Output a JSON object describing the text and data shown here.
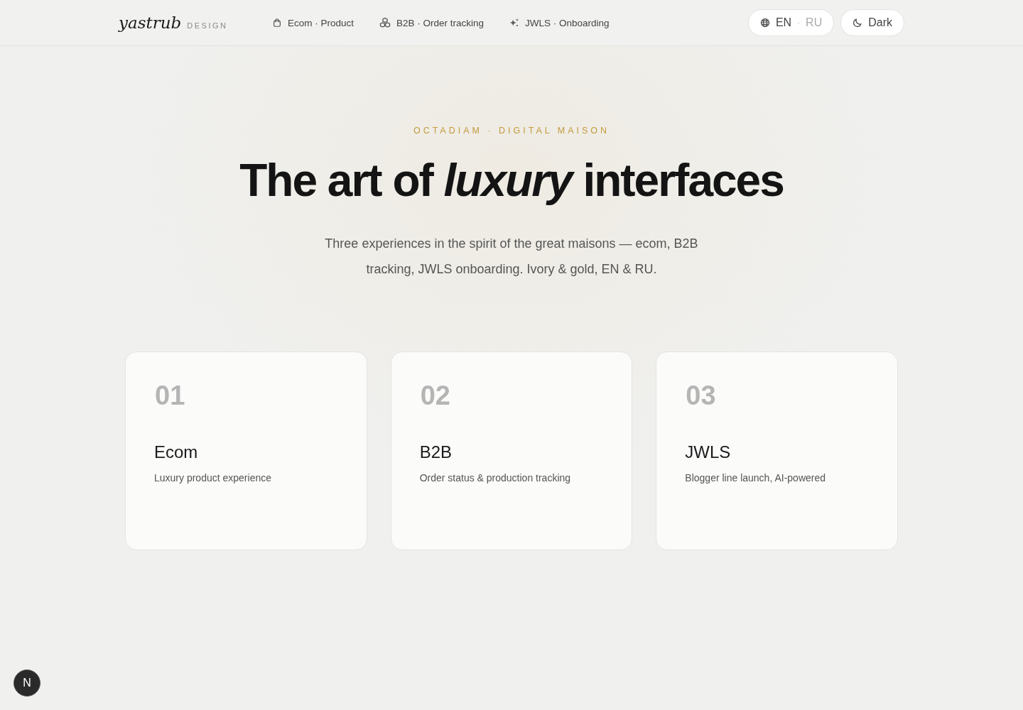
{
  "header": {
    "logo": "yastrub",
    "logo_sub": "DESIGN",
    "nav": [
      {
        "label": "Ecom · Product"
      },
      {
        "label": "B2B · Order tracking"
      },
      {
        "label": "JWLS · Onboarding"
      }
    ],
    "languages": [
      {
        "label": "EN",
        "selected": true
      },
      {
        "label": "RU",
        "selected": false
      }
    ],
    "language_separator": "·",
    "theme_button": "Dark"
  },
  "hero": {
    "eyebrow": "OCTADIAM · DIGITAL MAISON",
    "title": "The art of *luxury* interfaces",
    "subtitle": "Three experiences in the spirit of the great maisons — ecom, B2B tracking, JWLS onboarding. Ivory & gold, EN & RU."
  },
  "cards": [
    {
      "number": "01",
      "title": "Ecom",
      "description": "Luxury product experience"
    },
    {
      "number": "02",
      "title": "B2B",
      "description": "Order status & production tracking"
    },
    {
      "number": "03",
      "title": "JWLS",
      "description": "Blogger line launch, AI-powered"
    }
  ],
  "dev_badge": "N"
}
